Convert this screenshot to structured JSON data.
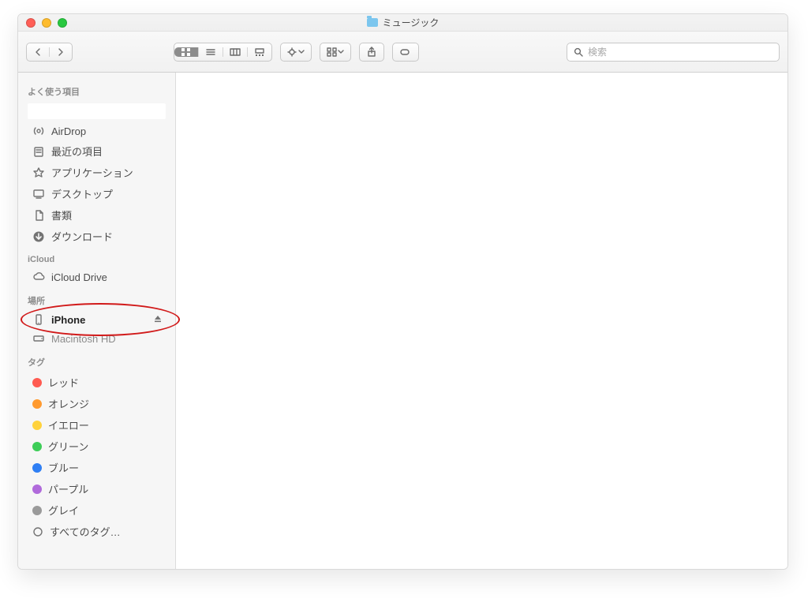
{
  "window": {
    "title": "ミュージック"
  },
  "search": {
    "placeholder": "検索"
  },
  "sidebar": {
    "favorites": {
      "header": "よく使う項目",
      "items": [
        {
          "label": "AirDrop"
        },
        {
          "label": "最近の項目"
        },
        {
          "label": "アプリケーション"
        },
        {
          "label": "デスクトップ"
        },
        {
          "label": "書類"
        },
        {
          "label": "ダウンロード"
        }
      ]
    },
    "icloud": {
      "header": "iCloud",
      "items": [
        {
          "label": "iCloud Drive"
        }
      ]
    },
    "locations": {
      "header": "場所",
      "items": [
        {
          "label": "iPhone",
          "ejectable": true,
          "selected": true
        },
        {
          "label": "Macintosh HD"
        }
      ]
    },
    "tags": {
      "header": "タグ",
      "items": [
        {
          "label": "レッド",
          "color": "#ff5b51"
        },
        {
          "label": "オレンジ",
          "color": "#ff9a2f"
        },
        {
          "label": "イエロー",
          "color": "#ffd23c"
        },
        {
          "label": "グリーン",
          "color": "#3dcd58"
        },
        {
          "label": "ブルー",
          "color": "#2f7ff4"
        },
        {
          "label": "パープル",
          "color": "#b06adb"
        },
        {
          "label": "グレイ",
          "color": "#9a9a9a"
        },
        {
          "label": "すべてのタグ…",
          "all": true
        }
      ]
    }
  },
  "annotation": {
    "highlight_target": "sidebar.locations.items.0"
  }
}
